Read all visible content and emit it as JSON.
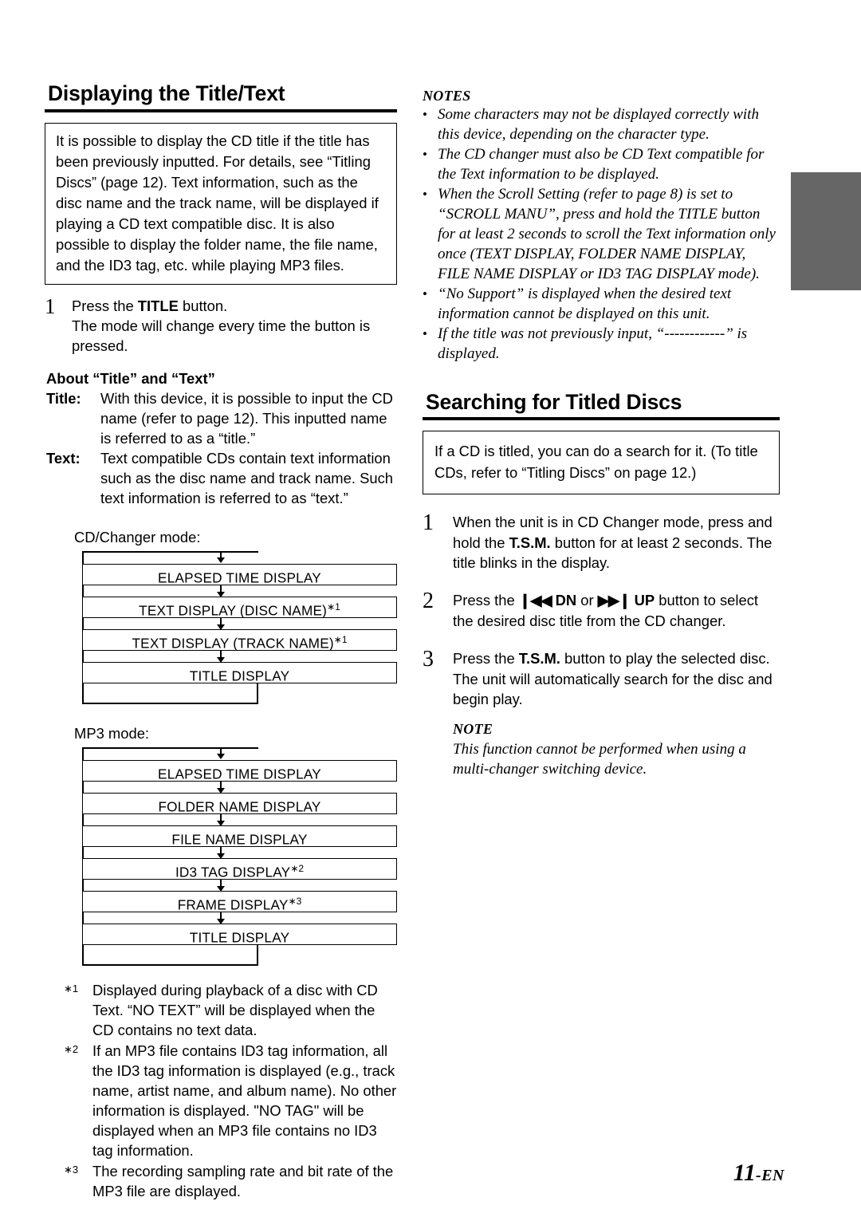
{
  "page": {
    "number_label": "11",
    "number_suffix": "-EN"
  },
  "left": {
    "heading": "Displaying the Title/Text",
    "intro_box": "It is possible to display the CD title if the title has been previously inputted. For details, see “Titling Discs” (page 12). Text information, such as the disc name and the track name, will be displayed if playing a CD text compatible disc. It is also possible to display the folder name, the file name, and the ID3 tag, etc. while playing MP3 files.",
    "step1": {
      "number": "1",
      "line1_pre": "Press the ",
      "line1_bold": "TITLE",
      "line1_post": " button.",
      "line2": "The mode will change every time the button is pressed."
    },
    "about_heading": "About “Title” and “Text”",
    "definitions": [
      {
        "term": "Title:",
        "desc": "With this device, it is possible to input the CD name (refer to page 12). This inputted name is referred to as a “title.”"
      },
      {
        "term": "Text:",
        "desc": "Text compatible CDs contain text information such as the disc name and track name. Such text information is referred to as “text.”"
      }
    ],
    "flow_cd": {
      "label": "CD/Changer mode:",
      "boxes": [
        {
          "text": "ELAPSED TIME DISPLAY",
          "note": ""
        },
        {
          "text": "TEXT DISPLAY (DISC NAME)",
          "note": "∗1"
        },
        {
          "text": "TEXT DISPLAY (TRACK NAME)",
          "note": "∗1"
        },
        {
          "text": "TITLE DISPLAY",
          "note": ""
        }
      ]
    },
    "flow_mp3": {
      "label": "MP3 mode:",
      "boxes": [
        {
          "text": "ELAPSED TIME DISPLAY",
          "note": ""
        },
        {
          "text": "FOLDER NAME DISPLAY",
          "note": ""
        },
        {
          "text": "FILE NAME DISPLAY",
          "note": ""
        },
        {
          "text": "ID3 TAG DISPLAY",
          "note": "∗2"
        },
        {
          "text": "FRAME DISPLAY",
          "note": "∗3"
        },
        {
          "text": "TITLE DISPLAY",
          "note": ""
        }
      ]
    },
    "footnotes": [
      {
        "mark": "∗1",
        "text": "Displayed during playback of a disc with CD Text. “NO TEXT” will be displayed when the CD contains no text data."
      },
      {
        "mark": "∗2",
        "text": "If an MP3 file contains ID3 tag information, all the ID3 tag information is displayed  (e.g., track name, artist name, and album name). No other information is displayed. \"NO TAG\" will be displayed when an MP3 file contains no ID3 tag information."
      },
      {
        "mark": "∗3",
        "text": "The recording sampling rate and bit rate of the MP3 file are displayed."
      }
    ]
  },
  "right": {
    "notes_title": "NOTES",
    "notes": [
      "Some characters may not be displayed correctly with this device, depending on the character type.",
      "The CD changer must also be CD Text compatible for the Text information to be displayed.",
      "When the Scroll Setting (refer to page 8) is set to “SCROLL MANU”, press and hold the TITLE button for at least 2 seconds to scroll the Text information only once (TEXT DISPLAY, FOLDER NAME DISPLAY, FILE NAME DISPLAY or ID3 TAG DISPLAY mode).",
      "“No Support” is displayed when the desired text information cannot be displayed on this unit.",
      "If the title was not previously input, “------------” is displayed."
    ],
    "heading": "Searching for Titled Discs",
    "intro_box": "If a CD is titled, you can do a search for it. (To title CDs, refer to “Titling Discs” on page 12.)",
    "step1": {
      "number": "1",
      "pre": "When the unit is in CD Changer mode, press and hold the ",
      "bold": "T.S.M.",
      "post": " button for at least 2 seconds. The title blinks in the display."
    },
    "step2": {
      "number": "2",
      "pre": "Press the ",
      "glyph_prev": "❙◀◀",
      "bold_dn": "DN",
      "mid": " or ",
      "glyph_next": "▶▶❙",
      "bold_up": "UP",
      "post": " button to select the desired disc title from the CD changer."
    },
    "step3": {
      "number": "3",
      "pre": "Press the ",
      "bold": "T.S.M.",
      "post": " button to play the selected disc. The unit will automatically search for the disc and begin play."
    },
    "note_title": "NOTE",
    "note_text": "This function cannot be performed when using a multi-changer switching device."
  }
}
